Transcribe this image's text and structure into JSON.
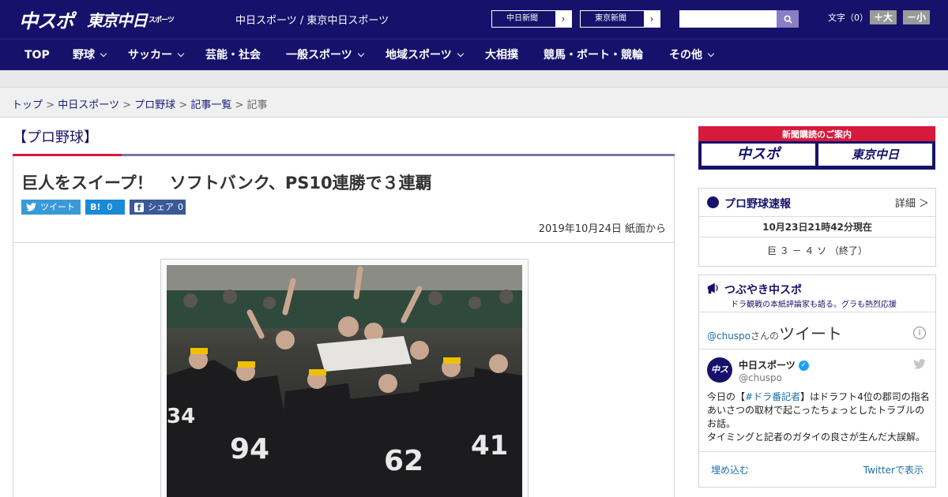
{
  "header": {
    "logo_chuspo": "中スポ",
    "logo_tokyo": "東京中日",
    "logo_tokyo_small": "スポーツ",
    "site_name": "中日スポーツ / 東京中日スポーツ",
    "links": [
      {
        "label": "中日新聞"
      },
      {
        "label": "東京新聞"
      }
    ],
    "font_size_label": "文字（0）",
    "font_plus": "＋大",
    "font_minus": "－小"
  },
  "nav": {
    "items": [
      {
        "label": "TOP",
        "dropdown": false
      },
      {
        "label": "野球",
        "dropdown": true
      },
      {
        "label": "サッカー",
        "dropdown": true
      },
      {
        "label": "芸能・社会",
        "dropdown": false
      },
      {
        "label": "一般スポーツ",
        "dropdown": true
      },
      {
        "label": "地域スポーツ",
        "dropdown": true
      },
      {
        "label": "大相撲",
        "dropdown": false
      },
      {
        "label": "競馬・ボート・競輪",
        "dropdown": false
      },
      {
        "label": "その他",
        "dropdown": true
      }
    ]
  },
  "breadcrumb": {
    "items": [
      "トップ",
      "中日スポーツ",
      "プロ野球",
      "記事一覧"
    ],
    "current": "記事",
    "separator": ">"
  },
  "article": {
    "category": "【プロ野球】",
    "headline": "巨人をスイープ！　ソフトバンク、PS10連勝で３連覇",
    "share_tweet": "ツイート",
    "share_hatena": "B!",
    "share_hatena_count": "0",
    "share_fb": "シェア",
    "share_fb_count": "0",
    "date": "2019年10月24日 紙面から"
  },
  "sidebar": {
    "subscribe_label": "新聞購読のご案内",
    "subscribe_chuspo": "中スポ",
    "subscribe_tokyo": "東京中日",
    "baseball": {
      "title": "プロ野球速報",
      "detail": "詳細 ＞",
      "timestamp": "10月23日21時42分現在",
      "score": "巨 ３ － ４ ソ （終了）"
    },
    "tsubuyaki": {
      "title": "つぶやき中スポ",
      "subtitle": "ドラ観戦の本紙評論家も語る。グラも熱烈応援",
      "tweets_by_handle": "@chuspo",
      "tweets_by_suffix": "さんの",
      "tweets_word": "ツイート",
      "account_name": "中日スポーツ",
      "account_handle": "@chuspo",
      "tweet_prefix": "今日の【",
      "tweet_hashtag": "#ドラ番記者",
      "tweet_rest": "】はドラフト4位の郡司の指名あいさつの取材で起こったちょっとしたトラブルのお話。",
      "tweet_line2": "タイミングと記者のガタイの良さが生んだ大誤解。",
      "embed": "埋め込む",
      "view_on_twitter": "Twitterで表示"
    }
  },
  "colors": {
    "header_bg": "#16126b",
    "accent_red": "#d7193c",
    "accent_purple": "#7b74ab"
  }
}
